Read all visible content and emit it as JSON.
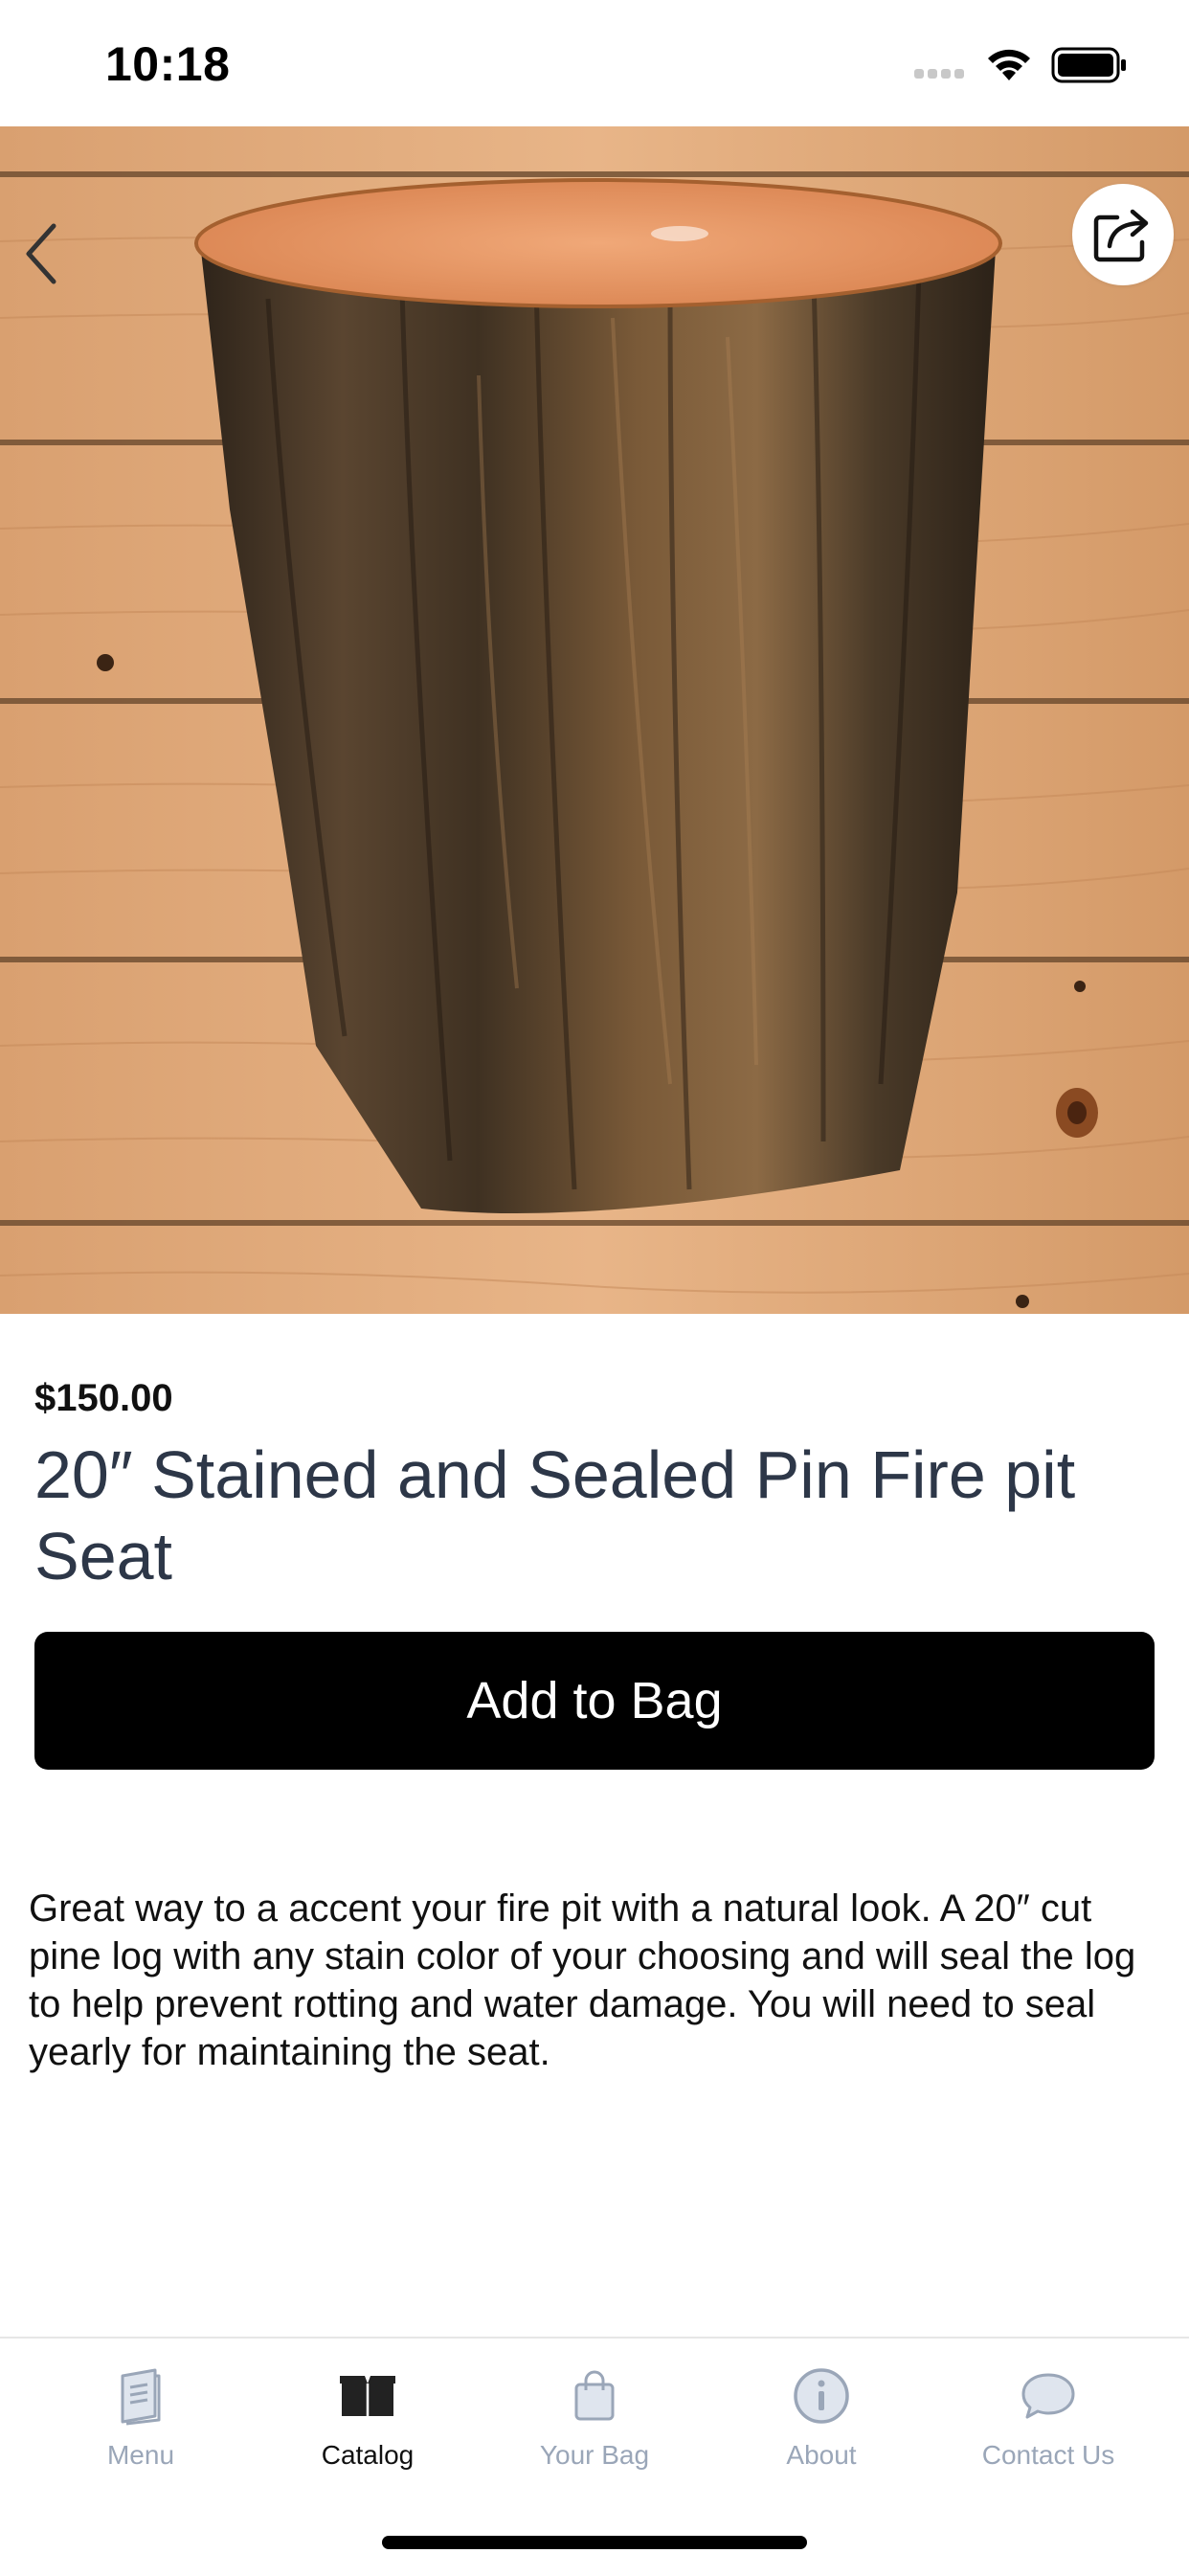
{
  "status_bar": {
    "time": "10:18"
  },
  "product": {
    "price": "$150.00",
    "title": "20″ Stained and Sealed Pin Fire pit Seat",
    "add_to_bag_label": "Add to Bag",
    "description": "Great way to a accent your fire pit with a natural look. A 20″ cut pine log with any stain color of your choosing and will seal the log to help prevent rotting and water damage. You will need to seal yearly for maintaining the seat."
  },
  "tabs": [
    {
      "label": "Menu",
      "icon": "menu-book-icon",
      "active": false
    },
    {
      "label": "Catalog",
      "icon": "catalog-box-icon",
      "active": true
    },
    {
      "label": "Your Bag",
      "icon": "shopping-bag-icon",
      "active": false
    },
    {
      "label": "About",
      "icon": "info-icon",
      "active": false
    },
    {
      "label": "Contact Us",
      "icon": "chat-bubble-icon",
      "active": false
    }
  ],
  "colors": {
    "active_tab": "#111111",
    "inactive_tab": "#9aa6b8",
    "title_text": "#2d3748",
    "button_bg": "#000000"
  }
}
